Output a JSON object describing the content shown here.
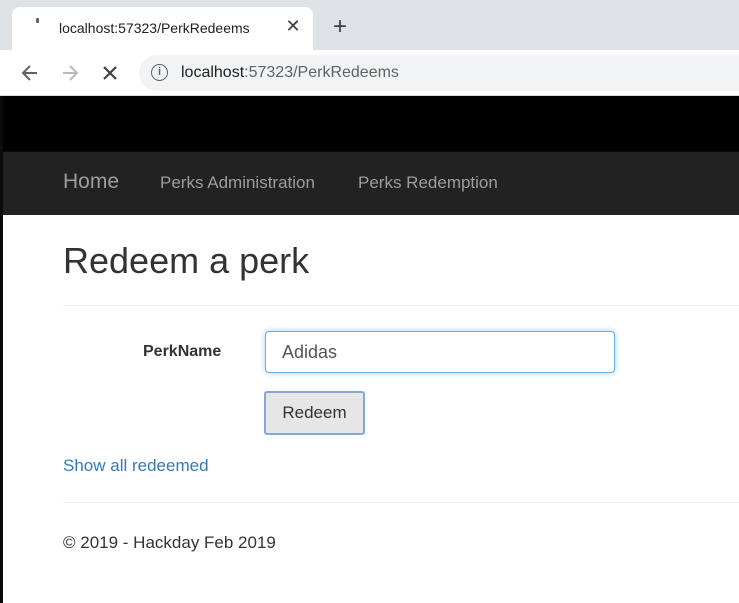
{
  "browser": {
    "tab_title": "localhost:57323/PerkRedeems",
    "tab_close_glyph": "✕",
    "new_tab_glyph": "+",
    "url_host": "localhost",
    "url_rest": ":57323/PerkRedeems",
    "icons": [
      "back-arrow-icon",
      "forward-arrow-icon",
      "stop-icon",
      "info-icon",
      "close-icon",
      "plus-icon"
    ]
  },
  "navbar": {
    "brand": "Home",
    "links": [
      "Perks Administration",
      "Perks Redemption"
    ]
  },
  "main": {
    "heading": "Redeem a perk",
    "field_label": "PerkName",
    "field_value": "Adidas",
    "submit_label": "Redeem",
    "link_label": "Show all redeemed"
  },
  "footer": {
    "text": "© 2019 - Hackday Feb 2019"
  },
  "colors": {
    "navbar_bg": "#222222",
    "top_band": "#000000",
    "link": "#337ab7",
    "focus_border": "#66afe9"
  }
}
